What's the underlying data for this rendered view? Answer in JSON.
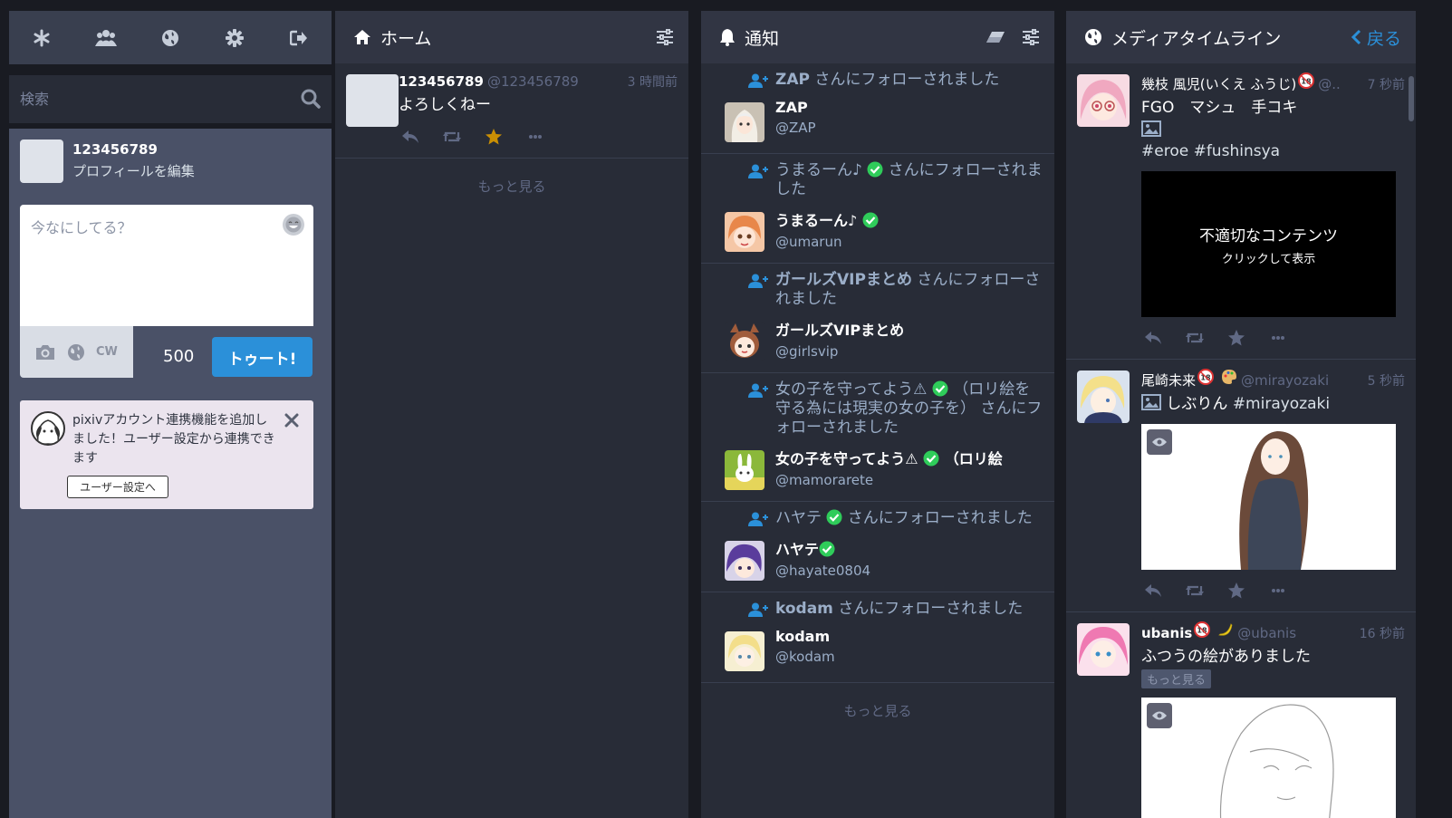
{
  "drawer": {
    "tabs": [
      "getting-started",
      "local-timeline",
      "federated-timeline",
      "preferences",
      "logout"
    ],
    "search_placeholder": "検索",
    "account": {
      "display_name": "123456789",
      "edit_label": "プロフィールを編集"
    },
    "compose": {
      "placeholder": "今なにしてる？",
      "cw_label": "CW",
      "char_count": "500",
      "toot_label": "トゥート!"
    },
    "notice": {
      "text": "pixivアカウント連携機能を追加しました！ユーザー設定から連携できます",
      "button_label": "ユーザー設定へ"
    }
  },
  "home": {
    "title": "ホーム",
    "statuses": [
      {
        "name": "123456789",
        "acct": "@123456789",
        "time": "3 時間前",
        "content": "よろしくねー",
        "favourited": true
      }
    ],
    "load_more": "もっと見る"
  },
  "notifications": {
    "title": "通知",
    "items": [
      {
        "line_name": "ZAP",
        "line_suffix": " さんにフォローされました",
        "verified": false,
        "acct_name": "ZAP",
        "acct_handle": "@ZAP"
      },
      {
        "line_name": "うまるーん♪",
        "line_suffix": " さんにフォローされました",
        "verified": true,
        "acct_name": "うまるーん♪",
        "acct_handle": "@umarun"
      },
      {
        "line_name": "ガールズVIPまとめ",
        "line_suffix": " さんにフォローされました",
        "verified": false,
        "acct_name": "ガールズVIPまとめ",
        "acct_handle": "@girlsvip"
      },
      {
        "line_name": "女の子を守ってよう⚠",
        "line_suffix": " （ロリ絵を守る為には現実の女の子を） さんにフォローされました",
        "verified": true,
        "acct_name": "女の子を守ってよう⚠",
        "acct_name_suffix": " （ロリ絵",
        "acct_handle": "@mamorarete"
      },
      {
        "line_name": "ハヤテ",
        "line_suffix": " さんにフォローされました",
        "verified": true,
        "acct_name": "ハヤテ",
        "acct_handle": "@hayate0804"
      },
      {
        "line_name": "kodam",
        "line_suffix": " さんにフォローされました",
        "verified": false,
        "acct_name": "kodam",
        "acct_handle": "@kodam"
      }
    ],
    "load_more": "もっと見る"
  },
  "media": {
    "title": "メディアタイムライン",
    "back_label": "戻る",
    "statuses": [
      {
        "name": "幾枝 風児(いくえ ふうじ)",
        "acct": "@..",
        "time": "7 秒前",
        "content": "FGO　マシュ　手コキ",
        "tags": "#eroe #fushinsya",
        "sensitive_title": "不適切なコンテンツ",
        "sensitive_sub": "クリックして表示"
      },
      {
        "name": "尾崎未来",
        "acct": "@mirayozaki",
        "time": "5 秒前",
        "content": "しぶりん ",
        "tag": "#mirayozaki"
      },
      {
        "name": "ubanis",
        "acct": "@ubanis",
        "time": "16 秒前",
        "content": "ふつうの絵がありました",
        "more_label": "もっと見る"
      }
    ]
  },
  "colors": {
    "accent": "#2b90d9",
    "fav": "#ca8f04",
    "verified": "#2fcc5a",
    "bg": "#191b22",
    "column": "#282c37"
  }
}
